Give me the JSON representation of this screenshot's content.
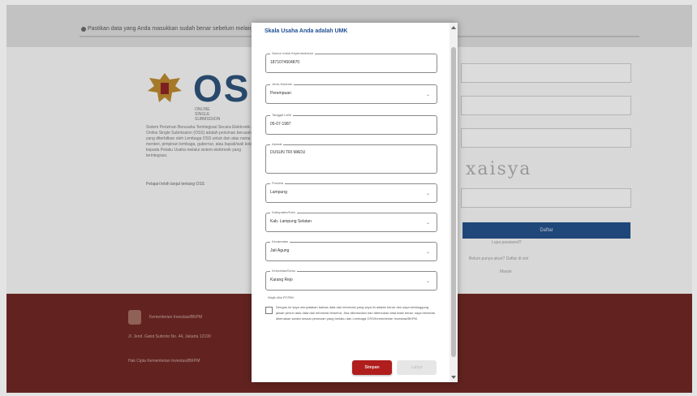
{
  "background": {
    "topbar_text": "Pastikan data yang Anda masukkan sudah benar sebelum melanjutkan proses",
    "logo_text": "OSS",
    "logo_subtitle": "ONLINE SINGLE SUBMISSION",
    "left_paragraph": "Sistem Perizinan Berusaha Terintegrasi Secara Elektronik atau Online Single Submission (OSS) adalah perizinan berusaha yang diterbitkan oleh Lembaga OSS untuk dan atas nama menteri, pimpinan lembaga, gubernur, atau bupati/wali kota kepada Pelaku Usaha melalui sistem elektronik yang terintegrasi.",
    "left_link": "Pelajari lebih lanjut tentang OSS",
    "captcha_text": "xaisya",
    "right_button": "Daftar",
    "right_link": "Lupa password?",
    "right_note": "Belum punya akun? Daftar di sini",
    "right_note2": "Masuk",
    "footer_title": "Kementerian Investasi/BKPM",
    "footer_address": "Jl. Jend. Gatot Subroto No. 44, Jakarta 12190",
    "footer_copyright": "Hak Cipta Kementerian Investasi/BKPM"
  },
  "modal": {
    "title": "Skala Usaha Anda adalah UMK",
    "fields": [
      {
        "label": "Nomor Induk Kependudukan",
        "value": "1871074504870",
        "type": "text"
      },
      {
        "label": "Jenis Kelamin",
        "value": "Perempuan",
        "type": "select"
      },
      {
        "label": "Tanggal Lahir",
        "value": "05-07-1987",
        "type": "text"
      },
      {
        "label": "Alamat",
        "value": "DUSUN TRI MADU",
        "type": "textarea"
      },
      {
        "label": "Provinsi",
        "value": "Lampung",
        "type": "select"
      },
      {
        "label": "Kabupaten/Kota",
        "value": "Kab. Lampung Selatan",
        "type": "select"
      },
      {
        "label": "Kecamatan",
        "value": "Jati Agung",
        "type": "select"
      },
      {
        "label": "Kelurahan/Desa",
        "value": "Karang Rejo",
        "type": "select"
      }
    ],
    "hint": "Wajib diisi RT/RW",
    "agreement": "Dengan ini saya menyatakan bahwa data dan informasi yang saya isi adalah benar dan saya bertanggung jawab penuh atas data dan informasi tersebut. Jika dikemudian hari ditemukan data tidak benar, saya bersedia dikenakan sanksi sesuai peraturan yang berlaku dan Lembaga OSS/Kementerian Investasi/BKPM.",
    "submit_label": "Simpan",
    "next_label": "Lanjut"
  },
  "colors": {
    "title": "#1f4f93",
    "submit": "#b01d1d",
    "footer": "#6b2420",
    "login_button": "#1f4d86"
  }
}
